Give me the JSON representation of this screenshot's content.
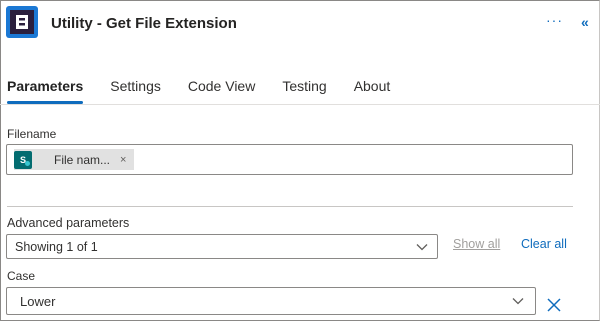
{
  "header": {
    "title": "Utility - Get File Extension",
    "more_label": "···",
    "collapse_label": "«",
    "logo_icon": "connector-logo-icon"
  },
  "tabs": [
    {
      "label": "Parameters",
      "active": true
    },
    {
      "label": "Settings",
      "active": false
    },
    {
      "label": "Code View",
      "active": false
    },
    {
      "label": "Testing",
      "active": false
    },
    {
      "label": "About",
      "active": false
    }
  ],
  "filename": {
    "label": "Filename",
    "token_text": "File nam...",
    "token_close": "×",
    "token_icon": "sharepoint-icon"
  },
  "advanced": {
    "label": "Advanced parameters",
    "selected": "Showing 1 of 1",
    "show_all": "Show all",
    "clear_all": "Clear all"
  },
  "case": {
    "label": "Case",
    "selected": "Lower"
  },
  "colors": {
    "accent": "#0f6cbd",
    "logo_bg": "#1b78d4",
    "sharepoint": "#036c70"
  }
}
